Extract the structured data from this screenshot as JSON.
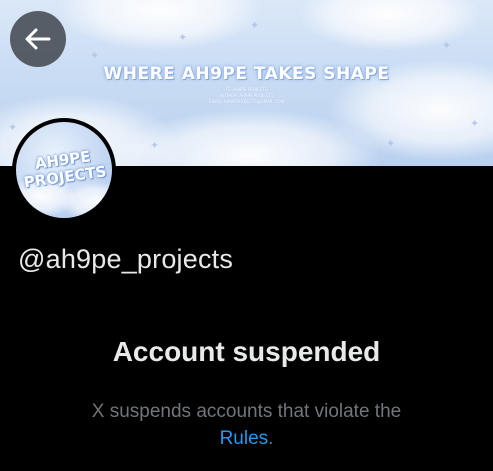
{
  "banner": {
    "title": "WHERE AH9PE TAKES SHAPE",
    "credits": [
      "TE: AH9PE PROJECTS",
      "HEOHEH: AH9PE PROJECTS",
      "EMAIL: AH9PEPROJECTS@GMAIL.COM"
    ]
  },
  "header": {
    "back_icon": "arrow-left-icon"
  },
  "avatar": {
    "line1": "AH9PE",
    "line2": "PROJECTS"
  },
  "profile": {
    "handle": "@ah9pe_projects"
  },
  "suspension": {
    "title": "Account suspended",
    "description": "X suspends accounts that violate the",
    "link_text": "Rules",
    "trailing": "."
  },
  "colors": {
    "background": "#000000",
    "text_primary": "#e7e9ea",
    "text_secondary": "#71767b",
    "link": "#1d9bf0",
    "banner_sky": "#c9dcf4"
  }
}
